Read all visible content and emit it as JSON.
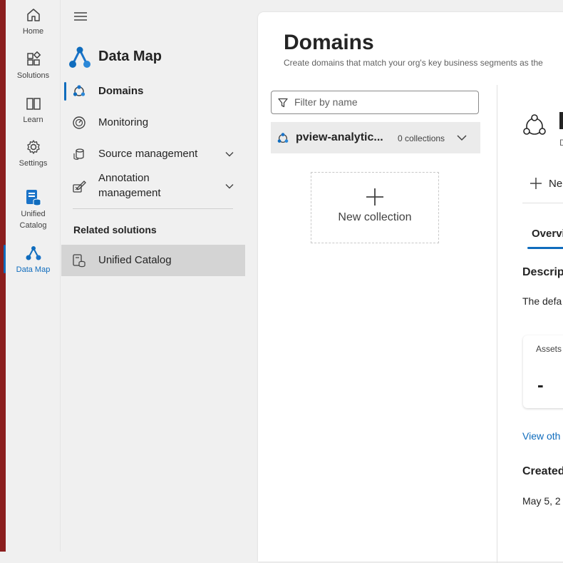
{
  "rail": {
    "items": [
      {
        "label": "Home",
        "icon": "home-icon"
      },
      {
        "label": "Solutions",
        "icon": "solutions-icon"
      },
      {
        "label": "Learn",
        "icon": "learn-book-icon"
      },
      {
        "label": "Settings",
        "icon": "gear-icon"
      },
      {
        "label": "Unified Catalog",
        "line1": "Unified",
        "line2": "Catalog",
        "icon": "unified-catalog-icon"
      },
      {
        "label": "Data Map",
        "icon": "data-map-icon"
      }
    ],
    "active": "Data Map"
  },
  "nav": {
    "title": "Data Map",
    "items": [
      {
        "label": "Domains",
        "icon": "domains-icon",
        "selected": true
      },
      {
        "label": "Monitoring",
        "icon": "monitoring-gauge-icon"
      },
      {
        "label": "Source management",
        "icon": "source-database-icon",
        "expandable": true
      },
      {
        "label": "Annotation management",
        "line1": "Annotation",
        "line2": "management",
        "icon": "annotation-icon",
        "expandable": true
      }
    ],
    "related_heading": "Related solutions",
    "related_items": [
      {
        "label": "Unified Catalog",
        "icon": "unified-catalog-icon"
      }
    ]
  },
  "main": {
    "title": "Domains",
    "subtitle": "Create domains that match your org's key business segments as the",
    "filter_placeholder": "Filter by name",
    "domain": {
      "name": "pview-analytic...",
      "collections": "0 collections"
    },
    "new_collection_label": "New collection"
  },
  "detail": {
    "new_button": "Ne",
    "tab_overview": "Overvi",
    "description_heading": "Descrip",
    "description_text": "The defa",
    "assets_label": "Assets",
    "assets_value": "-",
    "view_link": "View oth",
    "created_heading": "Created",
    "created_value": "May 5, 2",
    "small_text": "D"
  },
  "colors": {
    "accent": "#0f6cbd",
    "edge": "#8b1e1e",
    "highlight": "#d4d4d4"
  }
}
